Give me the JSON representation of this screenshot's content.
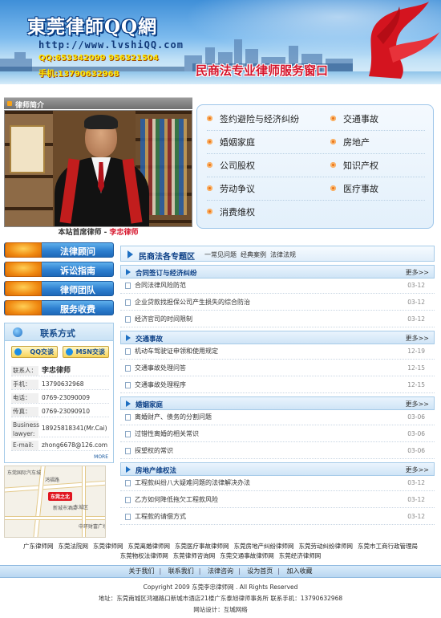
{
  "banner": {
    "site_title": "東莞律師QQ網",
    "url": "http://www.lvshiQQ.com",
    "qq": "QQ:653342099  956321504",
    "phone": "手机:13790632968",
    "slogan": "民商法专业律师服务窗口"
  },
  "intro": {
    "bar_label": "律师简介",
    "caption_prefix": "本站首席律师 - ",
    "caption_name": "李忠律师"
  },
  "practice_areas": {
    "left": [
      "签约避险与经济纠纷",
      "婚姻家庭",
      "公司股权",
      "劳动争议",
      "消费维权"
    ],
    "right": [
      "交通事故",
      "房地产",
      "知识产权",
      "医疗事故"
    ]
  },
  "left_nav": [
    "法律顾问",
    "诉讼指南",
    "律师团队",
    "服务收费"
  ],
  "contact": {
    "title": "联系方式",
    "qq_button": "QQ交谈",
    "msn_button": "MSN交谈",
    "rows": [
      {
        "label": "联系人：",
        "value": "李忠律师"
      },
      {
        "label": "手机：",
        "value": "13790632968"
      },
      {
        "label": "电话：",
        "value": "0769-23090009"
      },
      {
        "label": "传真：",
        "value": "0769-23090910"
      },
      {
        "label": "Business lawyer:",
        "value": "18925818341(Mr.Cai)"
      },
      {
        "label": "E-mail:",
        "value": "zhong6678@126.com"
      }
    ],
    "more": "MORE"
  },
  "map": {
    "pin": "东莞之北",
    "labels": [
      "东莞国际汽车城",
      "东城区",
      "新城市酒店",
      "中环财富广场",
      "鸿福路"
    ]
  },
  "topics": {
    "title": "民商法各专题区",
    "links": [
      "一常见问题",
      "经典案例",
      "法律法规"
    ],
    "more_label": "更多>>",
    "sections": [
      {
        "title": "合同签订与经济纠纷",
        "articles": [
          {
            "title": "合同法律风险防范",
            "date": "03-12"
          },
          {
            "title": "企业贷款找担保公司产生损失的综合防治",
            "date": "03-12"
          },
          {
            "title": "经济官司的时间限制",
            "date": "03-12"
          }
        ]
      },
      {
        "title": "交通事故",
        "articles": [
          {
            "title": "机动车驾驶证申领和使用规定",
            "date": "12-19"
          },
          {
            "title": "交通事故处理问答",
            "date": "12-15"
          },
          {
            "title": "交通事故处理程序",
            "date": "12-15"
          }
        ]
      },
      {
        "title": "婚姻家庭",
        "articles": [
          {
            "title": "离婚财产、债务的分割问题",
            "date": "03-06"
          },
          {
            "title": "过错性离婚的相关常识",
            "date": "03-06"
          },
          {
            "title": "探望权的常识",
            "date": "03-06"
          }
        ]
      },
      {
        "title": "房地产维权法",
        "articles": [
          {
            "title": "工程款纠纷八大疑难问题的法律解决办法",
            "date": "03-12"
          },
          {
            "title": "乙方如何降低拖欠工程款风险",
            "date": "03-12"
          },
          {
            "title": "工程款的请偿方式",
            "date": "03-12"
          }
        ]
      }
    ]
  },
  "footer": {
    "links": [
      "广东律师网",
      "东莞法院网",
      "东莞律师网",
      "东莞离婚律师网",
      "东莞医疗事故律师网",
      "东莞房地产纠纷律师网",
      "东莞劳动纠纷律师网",
      "东莞市工商行政管理局",
      "东莞物权法律师网",
      "东莞律师咨询网",
      "东莞交通事故律师网",
      "东莞经济律师网"
    ],
    "nav": [
      "关于我们",
      "联系我们",
      "法律咨询",
      "设为首页",
      "加入收藏"
    ],
    "copyright": "Copyright 2009 东莞李忠律师网 . All Rights Reserved",
    "address": "地址：东莞南城区鸿福路口新城市酒店21楼广东泰旭律师事务所   联系手机：13790632968",
    "design": "网站设计：互城网络"
  }
}
